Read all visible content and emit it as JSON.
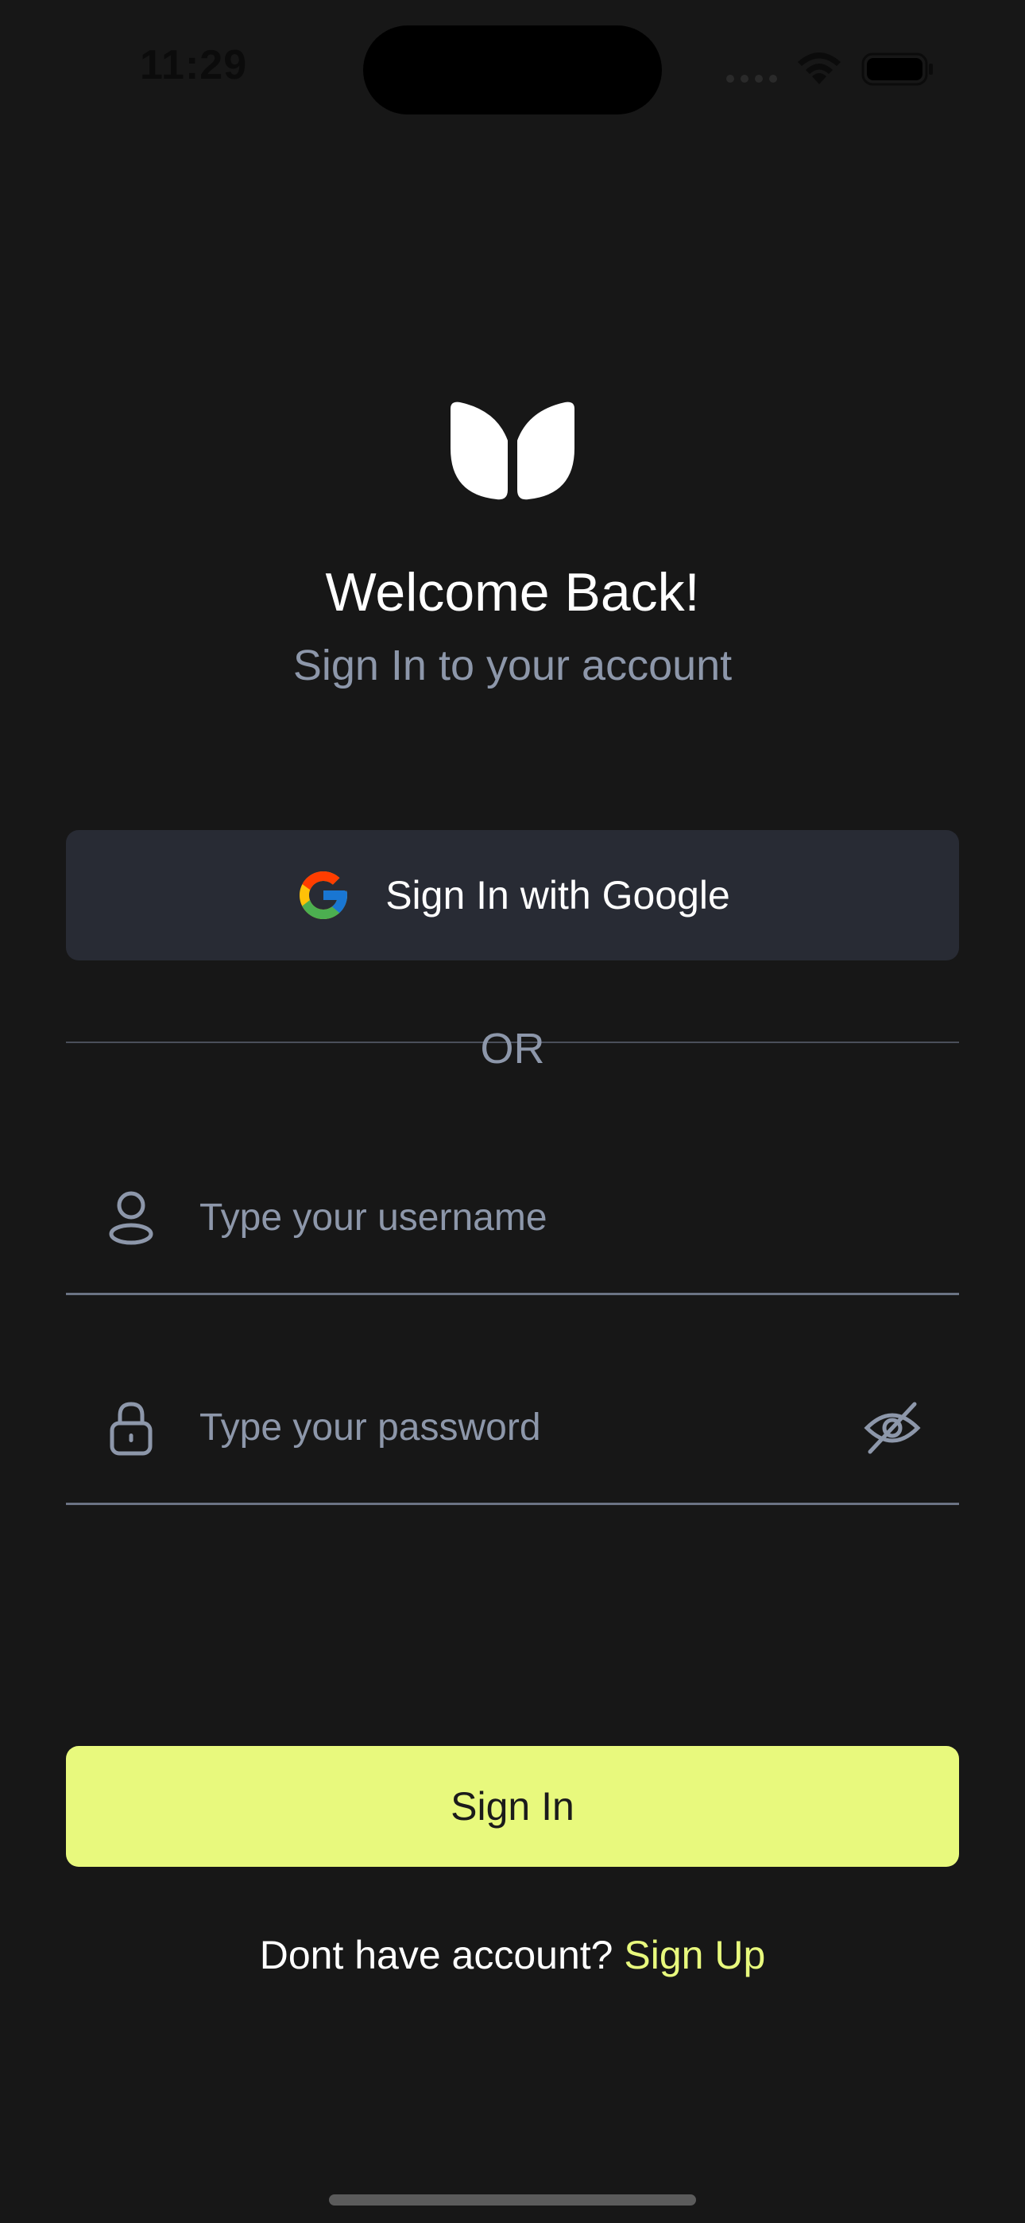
{
  "status_bar": {
    "time": "11:29",
    "icons": [
      "signal-icon",
      "wifi-icon",
      "battery-icon"
    ]
  },
  "header": {
    "logo": "app-logo",
    "title": "Welcome Back!",
    "subtitle": "Sign In to your account"
  },
  "google": {
    "icon": "google-icon",
    "label": "Sign In with Google"
  },
  "divider": {
    "label": "OR"
  },
  "form": {
    "username": {
      "icon": "user-icon",
      "placeholder": "Type your username",
      "value": ""
    },
    "password": {
      "icon": "lock-icon",
      "placeholder": "Type your password",
      "value": "",
      "toggle_icon": "eye-off-icon"
    }
  },
  "actions": {
    "sign_in_label": "Sign In",
    "signup_prompt": "Dont have account?",
    "signup_link": "Sign Up"
  },
  "colors": {
    "background": "#171717",
    "accent": "#e8f97d",
    "muted_text": "#8d97aa",
    "card": "#282b34"
  }
}
